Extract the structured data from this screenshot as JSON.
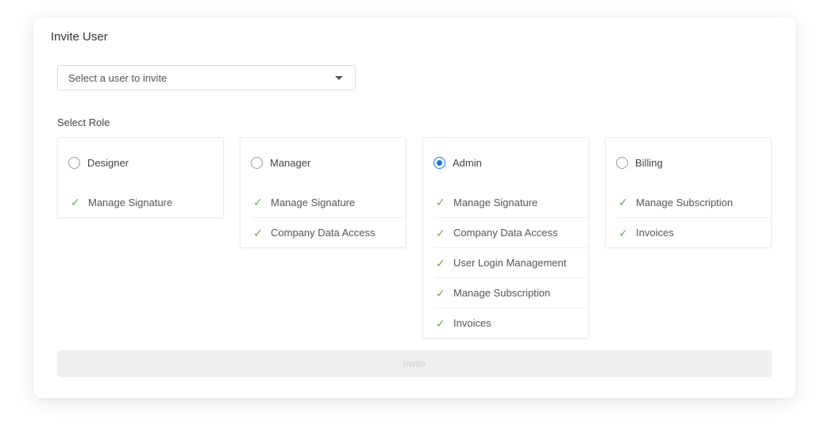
{
  "dialog": {
    "title": "Invite User",
    "user_select": {
      "placeholder": "Select a user to invite",
      "icon": "caret-down-icon"
    },
    "role_section_label": "Select Role",
    "roles": [
      {
        "name": "Designer",
        "selected": false,
        "permissions": [
          "Manage Signature"
        ]
      },
      {
        "name": "Manager",
        "selected": false,
        "permissions": [
          "Manage Signature",
          "Company Data Access"
        ]
      },
      {
        "name": "Admin",
        "selected": true,
        "permissions": [
          "Manage Signature",
          "Company Data Access",
          "User Login Management",
          "Manage Subscription",
          "Invoices"
        ]
      },
      {
        "name": "Billing",
        "selected": false,
        "permissions": [
          "Manage Subscription",
          "Invoices"
        ]
      }
    ],
    "check_glyph": "✓",
    "invite_button": {
      "label": "Invite",
      "disabled": true
    }
  },
  "colors": {
    "accent": "#1a73e8",
    "check": "#5fae4e",
    "disabled_bg": "#efefef",
    "disabled_text": "#d0d0d0"
  }
}
